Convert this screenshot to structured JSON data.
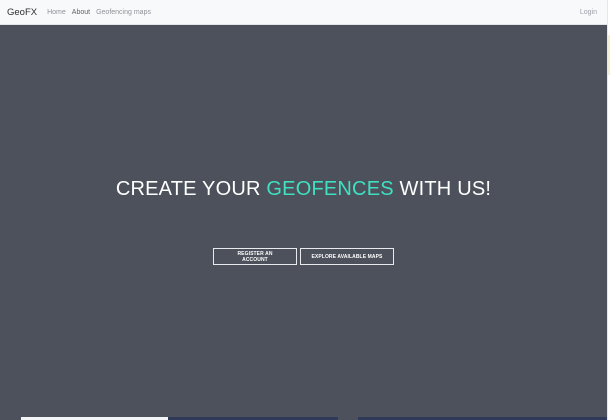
{
  "navbar": {
    "brand": "GeoFX",
    "links": [
      {
        "label": "Home"
      },
      {
        "label": "About"
      },
      {
        "label": "Geofencing maps"
      }
    ],
    "login_label": "Login"
  },
  "hero": {
    "title_prefix": "CREATE YOUR ",
    "title_accent": "GEOFENCES",
    "title_suffix": " WITH US!",
    "register_button": "REGISTER AN ACCOUNT",
    "explore_button": "EXPLORE AVAILABLE MAPS"
  },
  "colors": {
    "hero_background": "#4c515b",
    "accent": "#3fe0c1",
    "navbar_background": "#f8f9fa"
  }
}
